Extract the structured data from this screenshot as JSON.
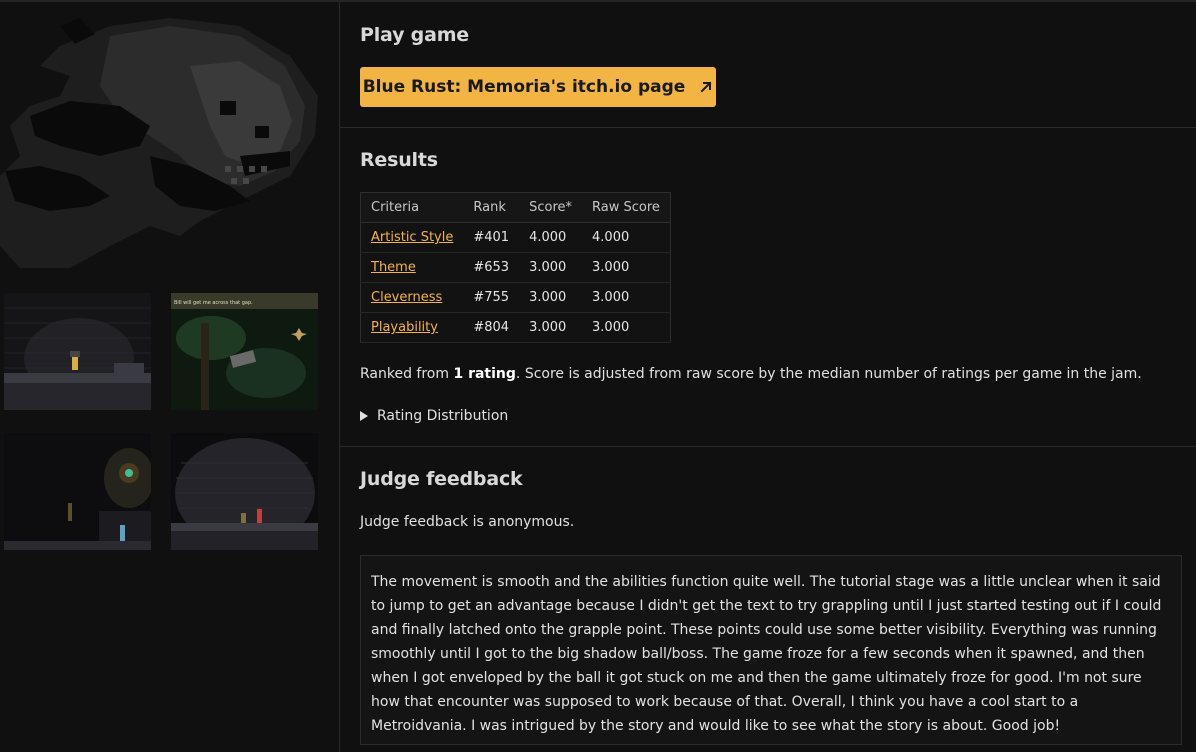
{
  "play_game": {
    "heading": "Play game",
    "itch_button_label": "Blue Rust: Memoria's itch.io page"
  },
  "results": {
    "heading": "Results",
    "columns": [
      "Criteria",
      "Rank",
      "Score*",
      "Raw Score"
    ],
    "rows": [
      {
        "criteria": "Artistic Style",
        "rank": "#401",
        "score": "4.000",
        "raw": "4.000"
      },
      {
        "criteria": "Theme",
        "rank": "#653",
        "score": "3.000",
        "raw": "3.000"
      },
      {
        "criteria": "Cleverness",
        "rank": "#755",
        "score": "3.000",
        "raw": "3.000"
      },
      {
        "criteria": "Playability",
        "rank": "#804",
        "score": "3.000",
        "raw": "3.000"
      }
    ],
    "ranked_prefix": "Ranked from ",
    "ranked_bold": "1 rating",
    "ranked_suffix": ". Score is adjusted from raw score by the median number of ratings per game in the jam.",
    "distribution_label": "Rating Distribution"
  },
  "judge": {
    "heading": "Judge feedback",
    "anonymous_note": "Judge feedback is anonymous.",
    "feedback_text": "The movement is smooth and the abilities function quite well. The tutorial stage was a little unclear when it said to jump to get an advantage because I didn't get the text to try grappling until I just started testing out if I could and finally latched onto the grapple point. These points could use some better visibility. Everything was running smoothly until I got to the big shadow ball/boss. The game froze for a few seconds when it spawned, and then when I got enveloped by the ball it got stuck on me and then the game ultimately froze for good. I'm not sure how that encounter was supposed to work because of that. Overall, I think you have a cool start to a Metroidvania. I was intrigued by the story and would like to see what the story is about. Good job!"
  },
  "screenshots": {
    "shot2_caption": "Bill will get me across that gap."
  },
  "colors": {
    "accent": "#f2b544",
    "background": "#101010",
    "text": "#dcdcdc"
  }
}
